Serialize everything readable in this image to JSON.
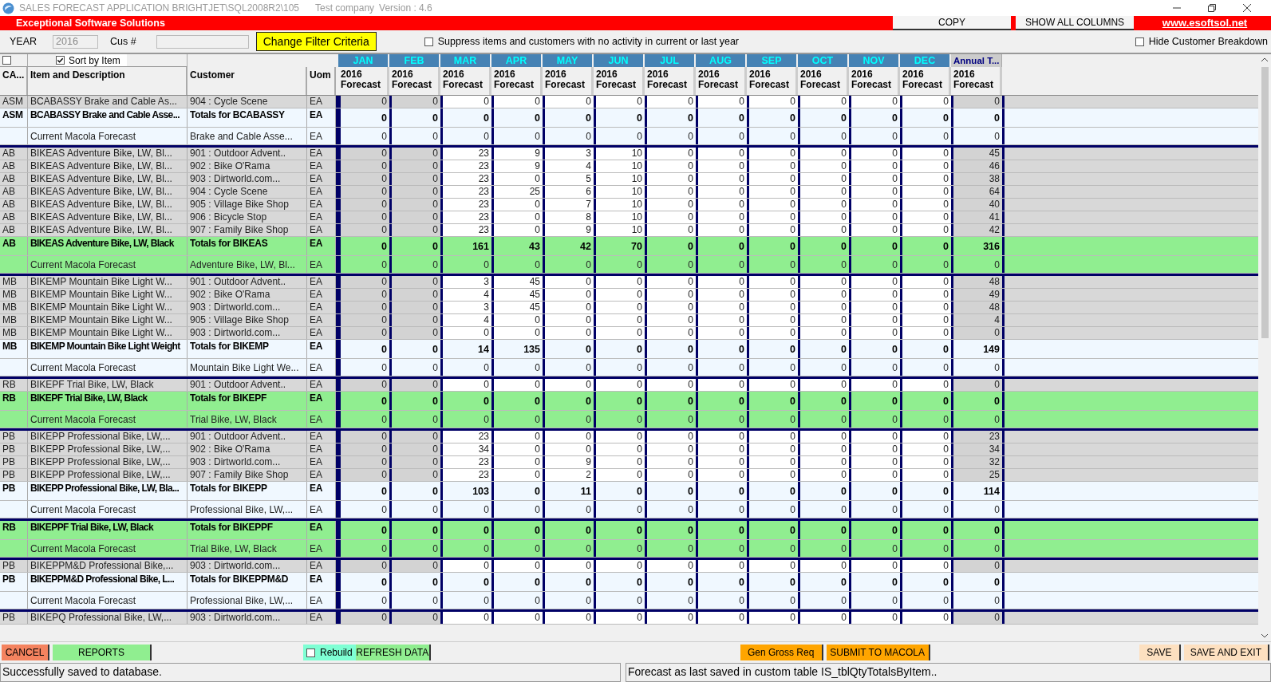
{
  "window": {
    "title": "SALES FORECAST APPLICATION  BRIGHTJET\\SQL2008R2\\105",
    "company": "Test company",
    "version": "Version : 4.6"
  },
  "banner": {
    "text": "Exceptional Software Solutions",
    "buttons": [
      "COPY",
      "SHOW ALL COLUMNS"
    ],
    "link": "www.esoftsol.net"
  },
  "filters": {
    "year_label": "YEAR",
    "year_value": "2016",
    "customer_label": "Cus #",
    "button": "Change Filter Criteria",
    "suppress": {
      "label": "Suppress items and customers with no activity in current or last year",
      "checked": false
    },
    "hide_breakdown": {
      "label": "Hide Customer Breakdown",
      "checked": false
    }
  },
  "table": {
    "select_all_checked": false,
    "sort_by_item": {
      "label": "Sort by Item",
      "checked": true
    },
    "months": [
      "JAN",
      "FEB",
      "MAR",
      "APR",
      "MAY",
      "JUN",
      "JUL",
      "AUG",
      "SEP",
      "OCT",
      "NOV",
      "DEC"
    ],
    "annual_label": "Annual T...",
    "columns": [
      "CA...",
      "Item and Description",
      "Customer",
      "Uom"
    ],
    "value_headers": [
      {
        "year": "2016",
        "label": "Forecast"
      },
      {
        "year": "2016",
        "label": "Forecast"
      },
      {
        "year": "2016",
        "label": "Forecast"
      },
      {
        "year": "2016",
        "label": "Forecast"
      },
      {
        "year": "2016",
        "label": "Forecast"
      },
      {
        "year": "2016",
        "label": "Forecast"
      },
      {
        "year": "2016",
        "label": "Forecast"
      },
      {
        "year": "2016",
        "label": "Forecast"
      },
      {
        "year": "2016",
        "label": "Forecast"
      },
      {
        "year": "2016",
        "label": "Forecast"
      },
      {
        "year": "2016",
        "label": "Forecast"
      },
      {
        "year": "2016",
        "label": "Forecast"
      },
      {
        "year": "2016",
        "label": "Forecast"
      }
    ],
    "rows": [
      {
        "kind": "detail",
        "cat": "ASM",
        "item": "BCABASSY  Brake and Cable As...",
        "customer": "904  :  Cycle Scene",
        "uom": "EA",
        "values": [
          "0",
          "0",
          "0",
          "0",
          "0",
          "0",
          "0",
          "0",
          "0",
          "0",
          "0",
          "0",
          "0"
        ]
      },
      {
        "kind": "total",
        "highlighted": false,
        "cat": "ASM",
        "item": "BCABASSY Brake and Cable Asse...",
        "customer": "Totals for BCABASSY",
        "uom": "EA",
        "values": [
          "0",
          "0",
          "0",
          "0",
          "0",
          "0",
          "0",
          "0",
          "0",
          "0",
          "0",
          "0",
          "0"
        ]
      },
      {
        "kind": "macola",
        "highlighted": false,
        "item": "Current Macola Forecast",
        "customer": "Brake and Cable Asse...",
        "uom": "EA",
        "values": [
          "0",
          "0",
          "0",
          "0",
          "0",
          "0",
          "0",
          "0",
          "0",
          "0",
          "0",
          "0",
          "0"
        ]
      },
      {
        "kind": "detail",
        "cat": "AB",
        "item": "BIKEAS  Adventure Bike, LW, Bl...",
        "customer": "901  :  Outdoor Advent..",
        "uom": "EA",
        "values": [
          "0",
          "0",
          "23",
          "9",
          "3",
          "10",
          "0",
          "0",
          "0",
          "0",
          "0",
          "0",
          "45"
        ]
      },
      {
        "kind": "detail",
        "cat": "AB",
        "item": "BIKEAS  Adventure Bike, LW, Bl...",
        "customer": "902  :  Bike O'Rama",
        "uom": "EA",
        "values": [
          "0",
          "0",
          "23",
          "9",
          "4",
          "10",
          "0",
          "0",
          "0",
          "0",
          "0",
          "0",
          "46"
        ]
      },
      {
        "kind": "detail",
        "cat": "AB",
        "item": "BIKEAS  Adventure Bike, LW, Bl...",
        "customer": "903  :  Dirtworld.com...",
        "uom": "EA",
        "values": [
          "0",
          "0",
          "23",
          "0",
          "5",
          "10",
          "0",
          "0",
          "0",
          "0",
          "0",
          "0",
          "38"
        ]
      },
      {
        "kind": "detail",
        "cat": "AB",
        "item": "BIKEAS  Adventure Bike, LW, Bl...",
        "customer": "904  :  Cycle Scene",
        "uom": "EA",
        "values": [
          "0",
          "0",
          "23",
          "25",
          "6",
          "10",
          "0",
          "0",
          "0",
          "0",
          "0",
          "0",
          "64"
        ]
      },
      {
        "kind": "detail",
        "cat": "AB",
        "item": "BIKEAS  Adventure Bike, LW, Bl...",
        "customer": "905  :  Village Bike Shop",
        "uom": "EA",
        "values": [
          "0",
          "0",
          "23",
          "0",
          "7",
          "10",
          "0",
          "0",
          "0",
          "0",
          "0",
          "0",
          "40"
        ]
      },
      {
        "kind": "detail",
        "cat": "AB",
        "item": "BIKEAS  Adventure Bike, LW, Bl...",
        "customer": "906  :  Bicycle Stop",
        "uom": "EA",
        "values": [
          "0",
          "0",
          "23",
          "0",
          "8",
          "10",
          "0",
          "0",
          "0",
          "0",
          "0",
          "0",
          "41"
        ]
      },
      {
        "kind": "detail",
        "cat": "AB",
        "item": "BIKEAS  Adventure Bike, LW, Bl...",
        "customer": "907  :  Family Bike Shop",
        "uom": "EA",
        "values": [
          "0",
          "0",
          "23",
          "0",
          "9",
          "10",
          "0",
          "0",
          "0",
          "0",
          "0",
          "0",
          "42"
        ]
      },
      {
        "kind": "total",
        "highlighted": true,
        "cat": "AB",
        "item": "BIKEAS Adventure Bike, LW, Black",
        "customer": "Totals for BIKEAS",
        "uom": "EA",
        "values": [
          "0",
          "0",
          "161",
          "43",
          "42",
          "70",
          "0",
          "0",
          "0",
          "0",
          "0",
          "0",
          "316"
        ]
      },
      {
        "kind": "macola",
        "highlighted": true,
        "item": "Current Macola Forecast",
        "customer": "Adventure Bike, LW, Bl...",
        "uom": "EA",
        "values": [
          "0",
          "0",
          "0",
          "0",
          "0",
          "0",
          "0",
          "0",
          "0",
          "0",
          "0",
          "0",
          "0"
        ]
      },
      {
        "kind": "detail",
        "cat": "MB",
        "item": "BIKEMP  Mountain Bike Light W...",
        "customer": "901  :  Outdoor Advent..",
        "uom": "EA",
        "values": [
          "0",
          "0",
          "3",
          "45",
          "0",
          "0",
          "0",
          "0",
          "0",
          "0",
          "0",
          "0",
          "48"
        ]
      },
      {
        "kind": "detail",
        "cat": "MB",
        "item": "BIKEMP  Mountain Bike Light W...",
        "customer": "902  :  Bike O'Rama",
        "uom": "EA",
        "values": [
          "0",
          "0",
          "4",
          "45",
          "0",
          "0",
          "0",
          "0",
          "0",
          "0",
          "0",
          "0",
          "49"
        ]
      },
      {
        "kind": "detail",
        "cat": "MB",
        "item": "BIKEMP  Mountain Bike Light W...",
        "customer": "903  :  Dirtworld.com...",
        "uom": "EA",
        "values": [
          "0",
          "0",
          "3",
          "45",
          "0",
          "0",
          "0",
          "0",
          "0",
          "0",
          "0",
          "0",
          "48"
        ]
      },
      {
        "kind": "detail",
        "cat": "MB",
        "item": "BIKEMP  Mountain Bike Light W...",
        "customer": "905  :  Village Bike Shop",
        "uom": "EA",
        "values": [
          "0",
          "0",
          "4",
          "0",
          "0",
          "0",
          "0",
          "0",
          "0",
          "0",
          "0",
          "0",
          "4"
        ]
      },
      {
        "kind": "detail",
        "cat": "MB",
        "item": "BIKEMP  Mountain Bike Light W...",
        "customer": "903  :  Dirtworld.com...",
        "uom": "EA",
        "values": [
          "0",
          "0",
          "0",
          "0",
          "0",
          "0",
          "0",
          "0",
          "0",
          "0",
          "0",
          "0",
          "0"
        ]
      },
      {
        "kind": "total",
        "highlighted": false,
        "cat": "MB",
        "item": "BIKEMP Mountain Bike Light Weight",
        "customer": "Totals for BIKEMP",
        "uom": "EA",
        "values": [
          "0",
          "0",
          "14",
          "135",
          "0",
          "0",
          "0",
          "0",
          "0",
          "0",
          "0",
          "0",
          "149"
        ]
      },
      {
        "kind": "macola",
        "highlighted": false,
        "item": "Current Macola Forecast",
        "customer": "Mountain Bike Light We...",
        "uom": "EA",
        "values": [
          "0",
          "0",
          "0",
          "0",
          "0",
          "0",
          "0",
          "0",
          "0",
          "0",
          "0",
          "0",
          "0"
        ]
      },
      {
        "kind": "detail",
        "cat": "RB",
        "item": "BIKEPF  Trial Bike, LW, Black",
        "customer": "901  :  Outdoor Advent..",
        "uom": "EA",
        "values": [
          "0",
          "0",
          "0",
          "0",
          "0",
          "0",
          "0",
          "0",
          "0",
          "0",
          "0",
          "0",
          "0"
        ]
      },
      {
        "kind": "total",
        "highlighted": true,
        "cat": "RB",
        "item": "BIKEPF Trial Bike, LW, Black",
        "customer": "Totals for BIKEPF",
        "uom": "EA",
        "values": [
          "0",
          "0",
          "0",
          "0",
          "0",
          "0",
          "0",
          "0",
          "0",
          "0",
          "0",
          "0",
          "0"
        ]
      },
      {
        "kind": "macola",
        "highlighted": true,
        "item": "Current Macola Forecast",
        "customer": "Trial Bike, LW, Black",
        "uom": "EA",
        "values": [
          "0",
          "0",
          "0",
          "0",
          "0",
          "0",
          "0",
          "0",
          "0",
          "0",
          "0",
          "0",
          "0"
        ]
      },
      {
        "kind": "detail",
        "cat": "PB",
        "item": "BIKEPP  Professional Bike, LW,...",
        "customer": "901  :  Outdoor Advent..",
        "uom": "EA",
        "values": [
          "0",
          "0",
          "23",
          "0",
          "0",
          "0",
          "0",
          "0",
          "0",
          "0",
          "0",
          "0",
          "23"
        ]
      },
      {
        "kind": "detail",
        "cat": "PB",
        "item": "BIKEPP  Professional Bike, LW,...",
        "customer": "902  :  Bike O'Rama",
        "uom": "EA",
        "values": [
          "0",
          "0",
          "34",
          "0",
          "0",
          "0",
          "0",
          "0",
          "0",
          "0",
          "0",
          "0",
          "34"
        ]
      },
      {
        "kind": "detail",
        "cat": "PB",
        "item": "BIKEPP  Professional Bike, LW,...",
        "customer": "903  :  Dirtworld.com...",
        "uom": "EA",
        "values": [
          "0",
          "0",
          "23",
          "0",
          "9",
          "0",
          "0",
          "0",
          "0",
          "0",
          "0",
          "0",
          "32"
        ]
      },
      {
        "kind": "detail",
        "cat": "PB",
        "item": "BIKEPP  Professional Bike, LW,...",
        "customer": "907  :  Family Bike Shop",
        "uom": "EA",
        "values": [
          "0",
          "0",
          "23",
          "0",
          "2",
          "0",
          "0",
          "0",
          "0",
          "0",
          "0",
          "0",
          "25"
        ]
      },
      {
        "kind": "total",
        "highlighted": false,
        "cat": "PB",
        "item": "BIKEPP Professional Bike, LW, Bla...",
        "customer": "Totals for BIKEPP",
        "uom": "EA",
        "values": [
          "0",
          "0",
          "103",
          "0",
          "11",
          "0",
          "0",
          "0",
          "0",
          "0",
          "0",
          "0",
          "114"
        ]
      },
      {
        "kind": "macola",
        "highlighted": false,
        "item": "Current Macola Forecast",
        "customer": "Professional Bike, LW,...",
        "uom": "EA",
        "values": [
          "0",
          "0",
          "0",
          "0",
          "0",
          "0",
          "0",
          "0",
          "0",
          "0",
          "0",
          "0",
          "0"
        ]
      },
      {
        "kind": "total",
        "highlighted": true,
        "cat": "RB",
        "item": "BIKEPPF Trial Bike, LW, Black",
        "customer": "Totals for BIKEPPF",
        "uom": "EA",
        "values": [
          "0",
          "0",
          "0",
          "0",
          "0",
          "0",
          "0",
          "0",
          "0",
          "0",
          "0",
          "0",
          "0"
        ]
      },
      {
        "kind": "macola",
        "highlighted": true,
        "item": "Current Macola Forecast",
        "customer": "Trial Bike, LW, Black",
        "uom": "EA",
        "values": [
          "0",
          "0",
          "0",
          "0",
          "0",
          "0",
          "0",
          "0",
          "0",
          "0",
          "0",
          "0",
          "0"
        ]
      },
      {
        "kind": "detail",
        "cat": "PB",
        "item": "BIKEPPM&D  Professional Bike,...",
        "customer": "903  :  Dirtworld.com...",
        "uom": "EA",
        "values": [
          "0",
          "0",
          "0",
          "0",
          "0",
          "0",
          "0",
          "0",
          "0",
          "0",
          "0",
          "0",
          "0"
        ]
      },
      {
        "kind": "total",
        "highlighted": false,
        "cat": "PB",
        "item": "BIKEPPM&D Professional Bike, L...",
        "customer": "Totals for BIKEPPM&D",
        "uom": "EA",
        "values": [
          "0",
          "0",
          "0",
          "0",
          "0",
          "0",
          "0",
          "0",
          "0",
          "0",
          "0",
          "0",
          "0"
        ]
      },
      {
        "kind": "macola",
        "highlighted": false,
        "item": "Current Macola Forecast",
        "customer": "Professional Bike, LW,...",
        "uom": "EA",
        "values": [
          "0",
          "0",
          "0",
          "0",
          "0",
          "0",
          "0",
          "0",
          "0",
          "0",
          "0",
          "0",
          "0"
        ]
      },
      {
        "kind": "detail",
        "cat": "PB",
        "item": "BIKEPQ  Professional Bike, LW,...",
        "customer": "903  :  Dirtworld.com...",
        "uom": "EA",
        "values": [
          "0",
          "0",
          "0",
          "0",
          "0",
          "0",
          "0",
          "0",
          "0",
          "0",
          "0",
          "0",
          "0"
        ]
      }
    ]
  },
  "toolbar": {
    "cancel": "CANCEL",
    "reports": "REPORTS",
    "rebuild": {
      "label": "Rebuild",
      "checked": false
    },
    "refresh": "REFRESH DATA",
    "gen_gross": "Gen Gross Req",
    "submit": "SUBMIT TO MACOLA",
    "save": "SAVE",
    "save_exit": "SAVE AND EXIT"
  },
  "status_bar": [
    "Successfully saved to database.",
    "Forecast as last saved in custom table IS_tblQtyTotalsByItem.."
  ]
}
